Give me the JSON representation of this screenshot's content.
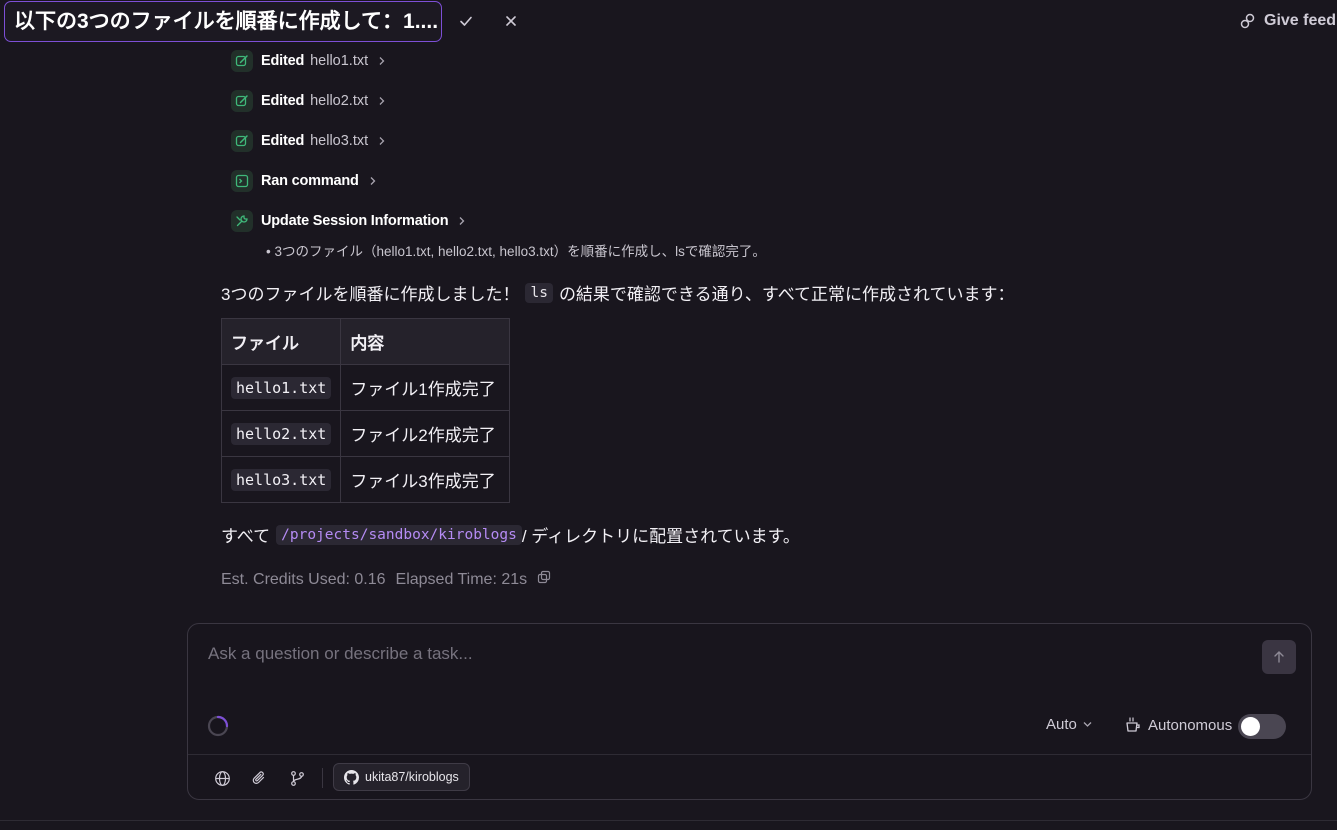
{
  "header": {
    "title": "以下の3つのファイルを順番に作成して：1....",
    "feedback_label": "Give feed"
  },
  "steps": [
    {
      "action": "Edited",
      "file": "hello1.txt",
      "icon": "edit-icon"
    },
    {
      "action": "Edited",
      "file": "hello2.txt",
      "icon": "edit-icon"
    },
    {
      "action": "Edited",
      "file": "hello3.txt",
      "icon": "edit-icon"
    },
    {
      "action": "Ran command",
      "file": "",
      "icon": "terminal-icon"
    },
    {
      "action": "Update Session Information",
      "file": "",
      "icon": "tools-icon"
    }
  ],
  "session_note": "• 3つのファイル（hello1.txt, hello2.txt, hello3.txt）を順番に作成し、lsで確認完了。",
  "message": {
    "intro_before": "3つのファイルを順番に作成しました！",
    "intro_code": "ls",
    "intro_after": "の結果で確認できる通り、すべて正常に作成されています：",
    "table": {
      "headers": [
        "ファイル",
        "内容"
      ],
      "rows": [
        [
          "hello1.txt",
          "ファイル1作成完了"
        ],
        [
          "hello2.txt",
          "ファイル2作成完了"
        ],
        [
          "hello3.txt",
          "ファイル3作成完了"
        ]
      ]
    },
    "outro_before": "すべて",
    "outro_path": "/projects/sandbox/kiroblogs",
    "outro_after": "/ ディレクトリに配置されています。"
  },
  "stats": {
    "credits": "Est. Credits Used: 0.16",
    "elapsed": "Elapsed Time: 21s"
  },
  "composer": {
    "placeholder": "Ask a question or describe a task...",
    "model": "Auto",
    "mode_label": "Autonomous",
    "autonomous_on": false,
    "repo": "ukita87/kiroblogs"
  },
  "colors": {
    "background": "#19161e",
    "accent": "#7d4fd6",
    "step_icon": "#3fb97a",
    "path_code": "#b58bf4"
  }
}
